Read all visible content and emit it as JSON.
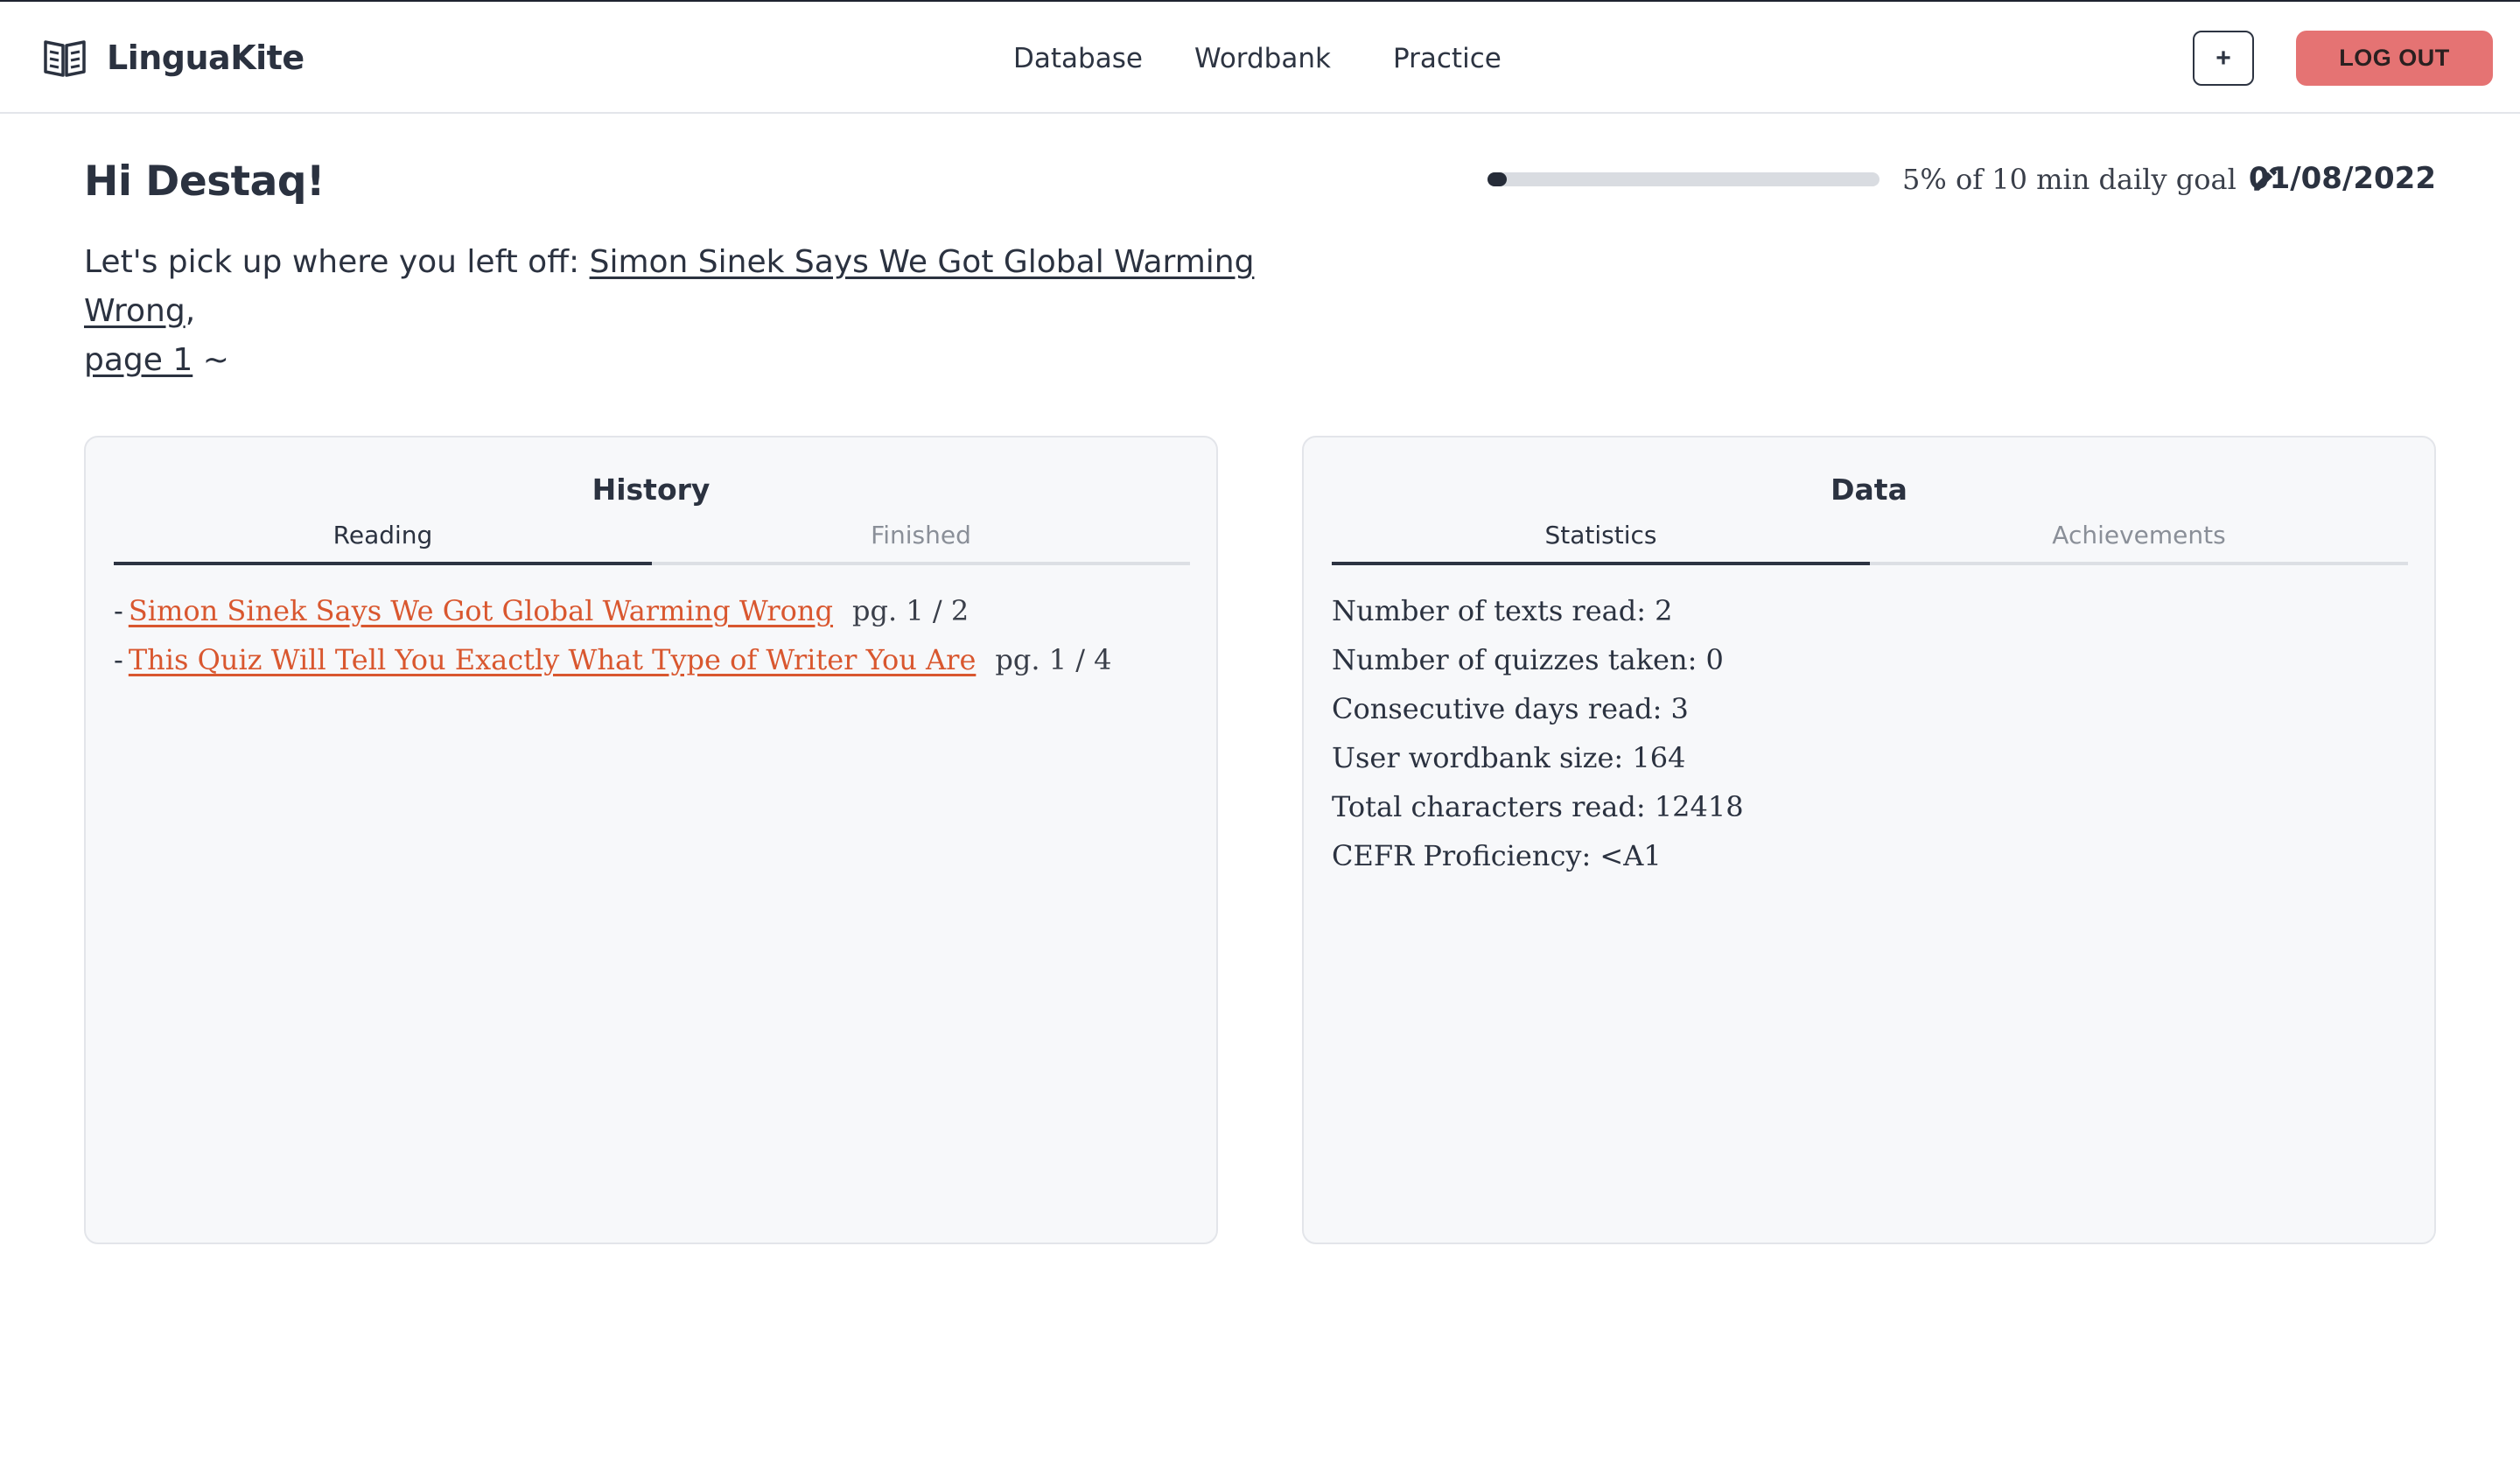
{
  "app": {
    "name": "LinguaKite",
    "logo_icon": "open-book-icon"
  },
  "nav": {
    "items": [
      "Database",
      "Wordbank",
      "Practice"
    ]
  },
  "header": {
    "add_label": "+",
    "logout_label": "LOG OUT"
  },
  "greeting": {
    "title": "Hi Destaq!",
    "resume_prefix": "Let's pick up where you left off: ",
    "resume_text_title": "Simon Sinek Says We Got Global Warming Wrong",
    "resume_separator": ",",
    "resume_page": "page 1",
    "resume_suffix": " ~"
  },
  "goal": {
    "progress_percent": 5,
    "label": "5% of 10 min daily goal",
    "edit_icon": "pencil-icon",
    "date": "01/08/2022"
  },
  "history": {
    "title": "History",
    "tabs": [
      "Reading",
      "Finished"
    ],
    "active_tab": "Reading",
    "items": [
      {
        "bullet": "-",
        "title": "Simon Sinek Says We Got Global Warming Wrong",
        "page": "pg. 1 / 2"
      },
      {
        "bullet": "-",
        "title": "This Quiz Will Tell You Exactly What Type of Writer You Are",
        "page": "pg. 1 / 4"
      }
    ]
  },
  "data": {
    "title": "Data",
    "tabs": [
      "Statistics",
      "Achievements"
    ],
    "active_tab": "Statistics",
    "stats": [
      "Number of texts read: 2",
      "Number of quizzes taken: 0",
      "Consecutive days read: 3",
      "User wordbank size: 164",
      "Total characters read: 12418",
      "CEFR Proficiency: <A1"
    ]
  },
  "colors": {
    "accent_link": "#d9572f",
    "logout_bg": "#e57373",
    "progress_fill": "#262c38",
    "progress_track": "#d9dce1",
    "card_bg": "#f7f8fa"
  }
}
